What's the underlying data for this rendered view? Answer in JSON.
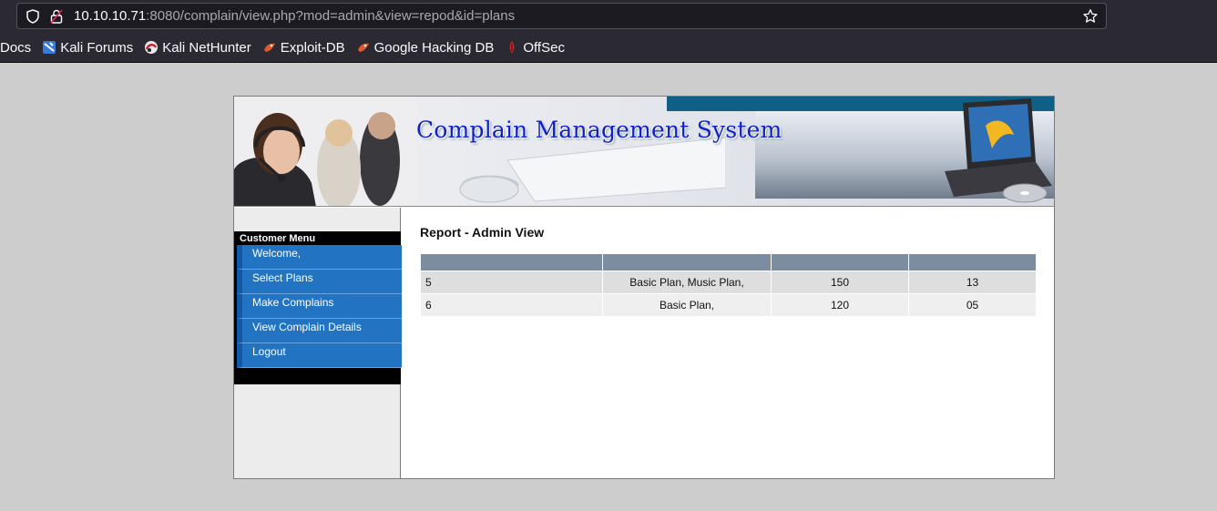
{
  "browser": {
    "url_host": "10.10.10.71",
    "url_rest": ":8080/complain/view.php?mod=admin&view=repod&id=plans",
    "bookmarks": [
      {
        "label": "Docs",
        "icon": "docs-icon"
      },
      {
        "label": "Kali Forums",
        "icon": "kali-forums-icon"
      },
      {
        "label": "Kali NetHunter",
        "icon": "kali-nethunter-icon"
      },
      {
        "label": "Exploit-DB",
        "icon": "exploit-db-icon"
      },
      {
        "label": "Google Hacking DB",
        "icon": "google-hacking-db-icon"
      },
      {
        "label": "OffSec",
        "icon": "offsec-icon"
      }
    ]
  },
  "banner": {
    "title": "Complain Management System"
  },
  "sidebar": {
    "title": "Customer Menu",
    "items": [
      {
        "label": "Welcome,"
      },
      {
        "label": "Select Plans"
      },
      {
        "label": "Make Complains"
      },
      {
        "label": "View Complain Details"
      },
      {
        "label": "Logout"
      }
    ]
  },
  "main": {
    "title": "Report - Admin View",
    "table": {
      "headers": [
        "",
        "",
        "",
        ""
      ],
      "rows": [
        [
          "5",
          "Basic Plan, Music Plan,",
          "150",
          "13"
        ],
        [
          "6",
          "Basic Plan,",
          "120",
          "05"
        ]
      ]
    }
  },
  "colors": {
    "menu_item_bg": "#2274c2",
    "table_header_bg": "#7c8da0",
    "title_blue": "#1020c8"
  }
}
